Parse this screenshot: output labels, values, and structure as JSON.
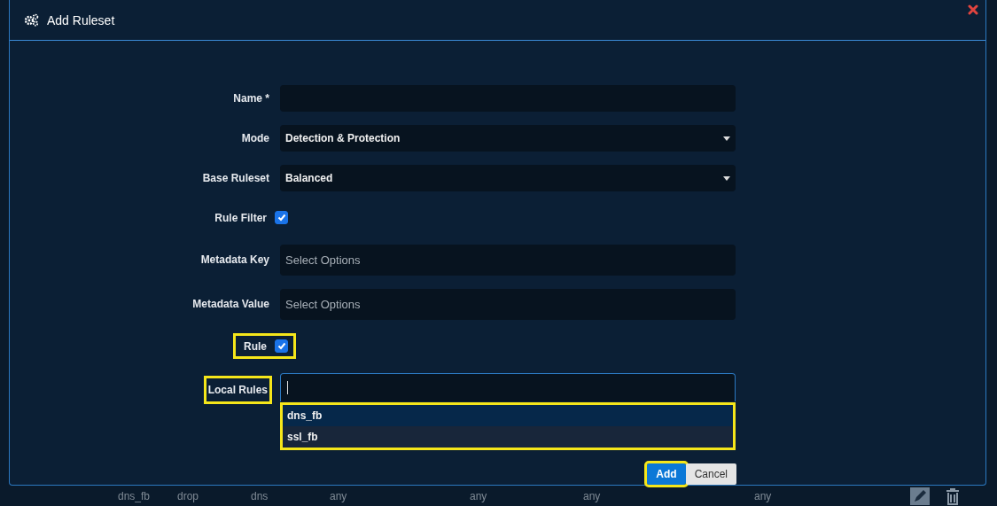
{
  "dialog": {
    "title": "Add Ruleset",
    "fields": [
      {
        "kind": "text",
        "label": "Name *",
        "highlighted": false
      },
      {
        "kind": "select",
        "label": "Mode",
        "value": "Detection & Protection",
        "highlighted": false
      },
      {
        "kind": "select",
        "label": "Base Ruleset",
        "value": "Balanced",
        "highlighted": false
      },
      {
        "kind": "checkbox",
        "label": "Rule Filter",
        "checked": true,
        "highlighted": false
      },
      {
        "kind": "multiselect",
        "label": "Metadata Key",
        "placeholder": "Select Options",
        "highlighted": false
      },
      {
        "kind": "multiselect",
        "label": "Metadata Value",
        "placeholder": "Select Options",
        "highlighted": false
      },
      {
        "kind": "checkbox",
        "label": "Rule",
        "checked": true,
        "highlighted": true
      },
      {
        "kind": "search",
        "label": "Local Rules",
        "highlighted": true,
        "options": [
          {
            "label": "dns_fb",
            "selected": true
          },
          {
            "label": "ssl_fb",
            "selected": false
          }
        ],
        "options_highlighted": true
      }
    ],
    "buttons": [
      {
        "label": "Add",
        "kind": "primary",
        "highlighted": true
      },
      {
        "label": "Cancel",
        "kind": "secondary",
        "highlighted": false
      }
    ]
  },
  "background_row": {
    "cells": [
      "dns_fb",
      "drop",
      "dns",
      "any",
      "any",
      "any",
      "any"
    ]
  }
}
